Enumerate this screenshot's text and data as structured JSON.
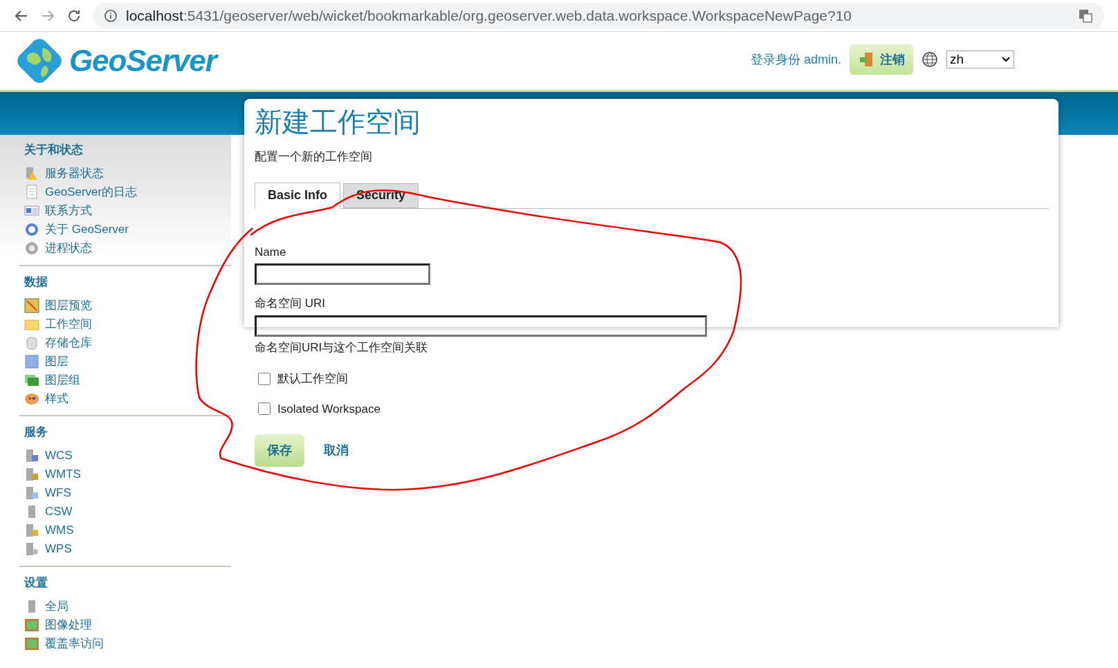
{
  "browser": {
    "url_host": "localhost",
    "url_rest": ":5431/geoserver/web/wicket/bookmarkable/org.geoserver.web.data.workspace.WorkspaceNewPage?10"
  },
  "header": {
    "logo_text": "GeoServer",
    "login_text": "登录身份 admin.",
    "logout_button": "注销",
    "language": "zh"
  },
  "sidebar": [
    {
      "title": "关于和状态",
      "items": [
        "服务器状态",
        "GeoServer的日志",
        "联系方式",
        "关于 GeoServer",
        "进程状态"
      ]
    },
    {
      "title": "数据",
      "items": [
        "图层预览",
        "工作空间",
        "存储仓库",
        "图层",
        "图层组",
        "样式"
      ]
    },
    {
      "title": "服务",
      "items": [
        "WCS",
        "WMTS",
        "WFS",
        "CSW",
        "WMS",
        "WPS"
      ]
    },
    {
      "title": "设置",
      "items": [
        "全局",
        "图像处理",
        "覆盖率访问"
      ]
    }
  ],
  "page": {
    "title": "新建工作空间",
    "description": "配置一个新的工作空间",
    "tabs": [
      {
        "label": "Basic Info",
        "selected": true
      },
      {
        "label": "Security",
        "selected": false
      }
    ],
    "fields": [
      {
        "label": "Name",
        "wide": false
      },
      {
        "label": "命名空间 URI",
        "wide": true,
        "help": "命名空间URI与这个工作空间关联"
      }
    ],
    "checkboxes": [
      {
        "label": "默认工作空间",
        "checked": false
      },
      {
        "label": "Isolated Workspace",
        "checked": false
      }
    ],
    "save_button": "保存",
    "cancel_link": "取消"
  }
}
